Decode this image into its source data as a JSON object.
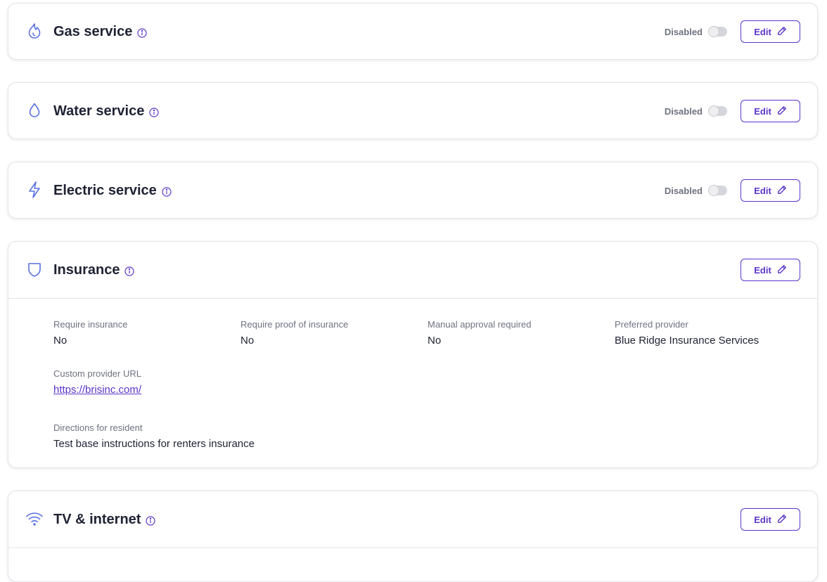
{
  "services": [
    {
      "title": "Gas service",
      "icon": "flame-icon",
      "status": "Disabled",
      "enabled": false,
      "edit_label": "Edit"
    },
    {
      "title": "Water service",
      "icon": "water-drop-icon",
      "status": "Disabled",
      "enabled": false,
      "edit_label": "Edit"
    },
    {
      "title": "Electric service",
      "icon": "lightning-icon",
      "status": "Disabled",
      "enabled": false,
      "edit_label": "Edit"
    }
  ],
  "insurance": {
    "title": "Insurance",
    "icon": "shield-icon",
    "edit_label": "Edit",
    "fields": {
      "require_insurance": {
        "label": "Require insurance",
        "value": "No"
      },
      "require_proof": {
        "label": "Require proof of insurance",
        "value": "No"
      },
      "manual_approval": {
        "label": "Manual approval required",
        "value": "No"
      },
      "preferred_provider": {
        "label": "Preferred provider",
        "value": "Blue Ridge Insurance Services"
      },
      "custom_provider_url": {
        "label": "Custom provider URL",
        "value": "https://brisinc.com/"
      },
      "directions": {
        "label": "Directions for resident",
        "value": "Test base instructions for renters insurance"
      }
    }
  },
  "tv_internet": {
    "title": "TV & internet",
    "icon": "wifi-icon",
    "edit_label": "Edit"
  },
  "colors": {
    "accent": "#5b35c9",
    "icon": "#5a72e0",
    "text": "#1f2233",
    "muted": "#6f7280"
  }
}
